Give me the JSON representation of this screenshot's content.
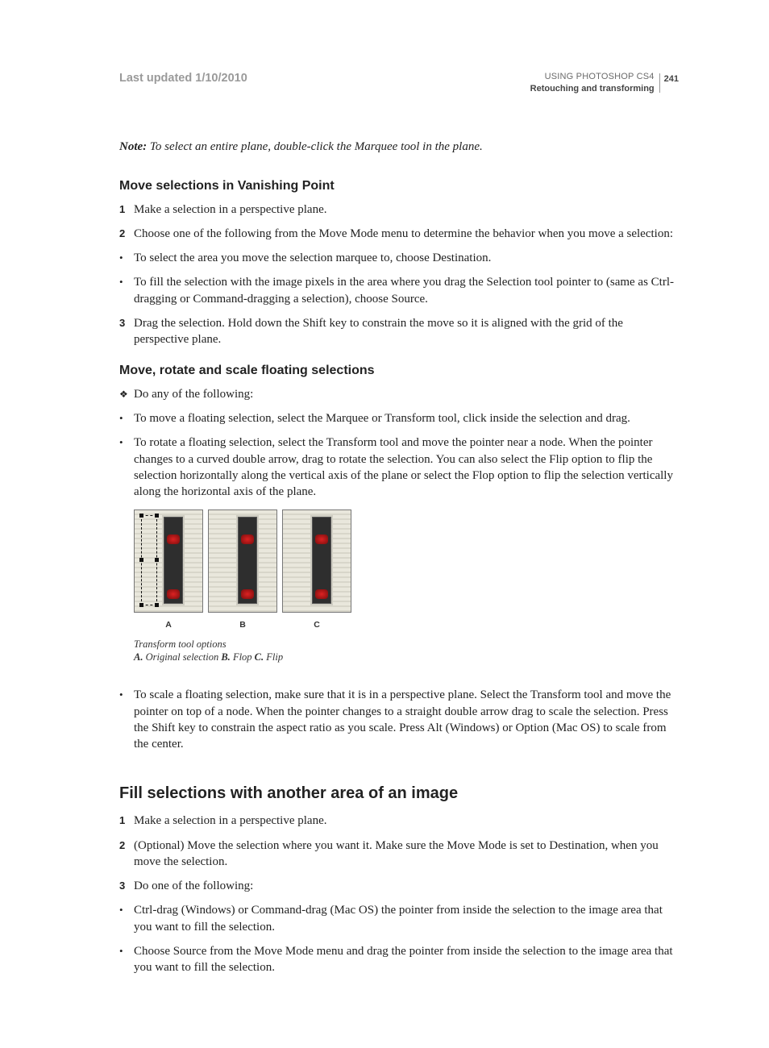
{
  "header": {
    "last_updated": "Last updated 1/10/2010",
    "doc_title": "USING PHOTOSHOP CS4",
    "section_title": "Retouching and transforming",
    "page_number": "241"
  },
  "note": {
    "label": "Note:",
    "text": " To select an entire plane, double-click the Marquee tool in the plane."
  },
  "sec1": {
    "heading": "Move selections in Vanishing Point",
    "items": [
      {
        "marker": "1",
        "type": "num",
        "text": "Make a selection in a perspective plane."
      },
      {
        "marker": "2",
        "type": "num",
        "text": "Choose one of the following from the Move Mode menu to determine the behavior when you move a selection:"
      },
      {
        "marker": "•",
        "type": "bullet",
        "text": "To select the area you move the selection marquee to, choose Destination."
      },
      {
        "marker": "•",
        "type": "bullet",
        "text": "To fill the selection with the image pixels in the area where you drag the Selection tool pointer to (same as Ctrl-dragging or Command-dragging a selection), choose Source."
      },
      {
        "marker": "3",
        "type": "num",
        "text": "Drag the selection. Hold down the Shift key to constrain the move so it is aligned with the grid of the perspective plane."
      }
    ]
  },
  "sec2": {
    "heading": "Move, rotate and scale floating selections",
    "items": [
      {
        "marker": "❖",
        "type": "diamond",
        "text": "Do any of the following:"
      },
      {
        "marker": "•",
        "type": "bullet",
        "text": "To move a floating selection, select the Marquee or Transform tool, click inside the selection and drag."
      },
      {
        "marker": "•",
        "type": "bullet",
        "text": "To rotate a floating selection, select the Transform tool and move the pointer near a node. When the pointer changes to a curved double arrow, drag to rotate the selection. You can also select the Flip option to flip the selection horizontally along the vertical axis of the plane or select the Flop option to flip the selection vertically along the horizontal axis of the plane."
      }
    ],
    "figure": {
      "labels": {
        "a": "A",
        "b": "B",
        "c": "C"
      },
      "caption_title": "Transform tool options",
      "caption_parts": {
        "a_key": "A.",
        "a_val": " Original selection  ",
        "b_key": "B.",
        "b_val": " Flop  ",
        "c_key": "C.",
        "c_val": " Flip"
      }
    },
    "after_items": [
      {
        "marker": "•",
        "type": "bullet",
        "text": "To scale a floating selection, make sure that it is in a perspective plane. Select the Transform tool and move the pointer on top of a node. When the pointer changes to a straight double arrow drag to scale the selection. Press the Shift key to constrain the aspect ratio as you scale. Press Alt (Windows) or Option (Mac OS) to scale from the center."
      }
    ]
  },
  "sec3": {
    "heading": "Fill selections with another area of an image",
    "items": [
      {
        "marker": "1",
        "type": "num",
        "text": "Make a selection in a perspective plane."
      },
      {
        "marker": "2",
        "type": "num",
        "text": "(Optional) Move the selection where you want it. Make sure the Move Mode is set to Destination, when you move the selection."
      },
      {
        "marker": "3",
        "type": "num",
        "text": " Do one of the following:"
      },
      {
        "marker": "•",
        "type": "bullet",
        "text": "Ctrl-drag (Windows) or Command-drag (Mac OS) the pointer from inside the selection to the image area that you want to fill the selection."
      },
      {
        "marker": "•",
        "type": "bullet",
        "text": "Choose Source from the Move Mode menu and drag the pointer from inside the selection to the image area that you want to fill the selection."
      }
    ]
  }
}
